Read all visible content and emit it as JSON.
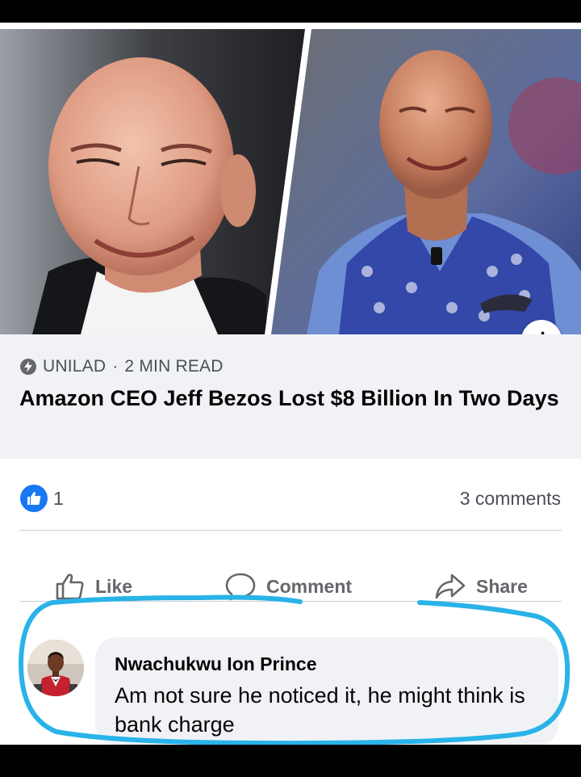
{
  "post": {
    "link": {
      "source": "UNILAD",
      "separator": "·",
      "read_time": "2 MIN READ",
      "headline": "Amazon CEO Jeff Bezos Lost $8 Billion In Two Days",
      "info_icon": "i"
    },
    "reactions": {
      "like_count": "1",
      "comments_count": "3 comments"
    },
    "actions": {
      "like_label": "Like",
      "comment_label": "Comment",
      "share_label": "Share"
    }
  },
  "comment": {
    "author": "Nwachukwu Ion Prince",
    "text": "Am not sure he noticed it, he might think is bank charge"
  },
  "icons": {
    "source": "bolt-icon",
    "info": "info-icon",
    "like_reaction": "thumbs-up-icon",
    "like": "thumbs-up-outline-icon",
    "comment": "speech-bubble-icon",
    "share": "share-arrow-icon"
  },
  "colors": {
    "accent": "#1877f2",
    "highlight_stroke": "#29b3e8",
    "muted_text": "#65676b",
    "bubble_bg": "#f0f2f5"
  }
}
